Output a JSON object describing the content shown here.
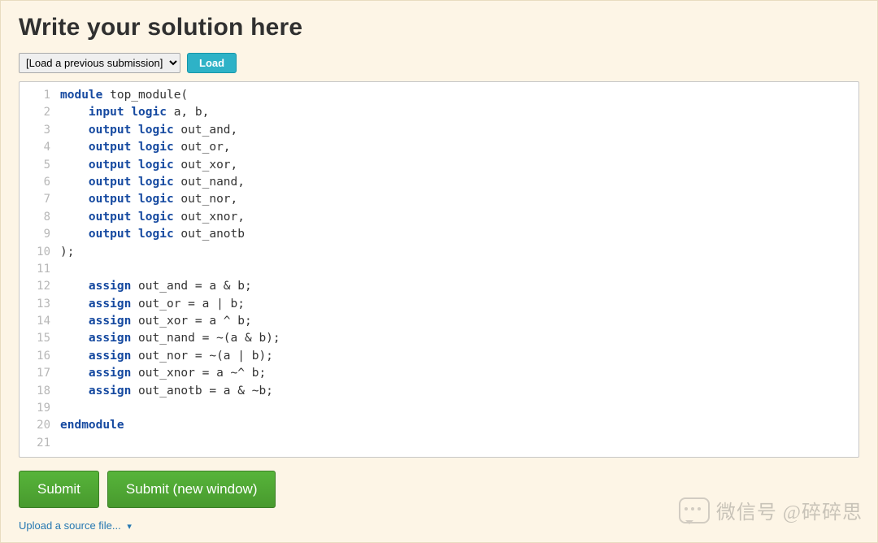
{
  "header": {
    "title": "Write your solution here"
  },
  "toolbar": {
    "prev_submission_selected": "[Load a previous submission]",
    "load_label": "Load"
  },
  "code": {
    "lines": [
      {
        "n": 1,
        "tokens": [
          {
            "c": "k",
            "t": "module"
          },
          {
            "c": "fn",
            "t": " top_module("
          }
        ]
      },
      {
        "n": 2,
        "tokens": [
          {
            "c": "fn",
            "t": "    "
          },
          {
            "c": "k",
            "t": "input"
          },
          {
            "c": "fn",
            "t": " "
          },
          {
            "c": "k",
            "t": "logic"
          },
          {
            "c": "fn",
            "t": " a, b,"
          }
        ]
      },
      {
        "n": 3,
        "tokens": [
          {
            "c": "fn",
            "t": "    "
          },
          {
            "c": "k",
            "t": "output"
          },
          {
            "c": "fn",
            "t": " "
          },
          {
            "c": "k",
            "t": "logic"
          },
          {
            "c": "fn",
            "t": " out_and,"
          }
        ]
      },
      {
        "n": 4,
        "tokens": [
          {
            "c": "fn",
            "t": "    "
          },
          {
            "c": "k",
            "t": "output"
          },
          {
            "c": "fn",
            "t": " "
          },
          {
            "c": "k",
            "t": "logic"
          },
          {
            "c": "fn",
            "t": " out_or,"
          }
        ]
      },
      {
        "n": 5,
        "tokens": [
          {
            "c": "fn",
            "t": "    "
          },
          {
            "c": "k",
            "t": "output"
          },
          {
            "c": "fn",
            "t": " "
          },
          {
            "c": "k",
            "t": "logic"
          },
          {
            "c": "fn",
            "t": " out_xor,"
          }
        ]
      },
      {
        "n": 6,
        "tokens": [
          {
            "c": "fn",
            "t": "    "
          },
          {
            "c": "k",
            "t": "output"
          },
          {
            "c": "fn",
            "t": " "
          },
          {
            "c": "k",
            "t": "logic"
          },
          {
            "c": "fn",
            "t": " out_nand,"
          }
        ]
      },
      {
        "n": 7,
        "tokens": [
          {
            "c": "fn",
            "t": "    "
          },
          {
            "c": "k",
            "t": "output"
          },
          {
            "c": "fn",
            "t": " "
          },
          {
            "c": "k",
            "t": "logic"
          },
          {
            "c": "fn",
            "t": " out_nor,"
          }
        ]
      },
      {
        "n": 8,
        "tokens": [
          {
            "c": "fn",
            "t": "    "
          },
          {
            "c": "k",
            "t": "output"
          },
          {
            "c": "fn",
            "t": " "
          },
          {
            "c": "k",
            "t": "logic"
          },
          {
            "c": "fn",
            "t": " out_xnor,"
          }
        ]
      },
      {
        "n": 9,
        "tokens": [
          {
            "c": "fn",
            "t": "    "
          },
          {
            "c": "k",
            "t": "output"
          },
          {
            "c": "fn",
            "t": " "
          },
          {
            "c": "k",
            "t": "logic"
          },
          {
            "c": "fn",
            "t": " out_anotb"
          }
        ]
      },
      {
        "n": 10,
        "tokens": [
          {
            "c": "fn",
            "t": ");"
          }
        ]
      },
      {
        "n": 11,
        "tokens": [
          {
            "c": "fn",
            "t": ""
          }
        ]
      },
      {
        "n": 12,
        "tokens": [
          {
            "c": "fn",
            "t": "    "
          },
          {
            "c": "k",
            "t": "assign"
          },
          {
            "c": "fn",
            "t": " out_and = a & b;"
          }
        ]
      },
      {
        "n": 13,
        "tokens": [
          {
            "c": "fn",
            "t": "    "
          },
          {
            "c": "k",
            "t": "assign"
          },
          {
            "c": "fn",
            "t": " out_or = a | b;"
          }
        ]
      },
      {
        "n": 14,
        "tokens": [
          {
            "c": "fn",
            "t": "    "
          },
          {
            "c": "k",
            "t": "assign"
          },
          {
            "c": "fn",
            "t": " out_xor = a ^ b;"
          }
        ]
      },
      {
        "n": 15,
        "tokens": [
          {
            "c": "fn",
            "t": "    "
          },
          {
            "c": "k",
            "t": "assign"
          },
          {
            "c": "fn",
            "t": " out_nand = ~(a & b);"
          }
        ]
      },
      {
        "n": 16,
        "tokens": [
          {
            "c": "fn",
            "t": "    "
          },
          {
            "c": "k",
            "t": "assign"
          },
          {
            "c": "fn",
            "t": " out_nor = ~(a | b);"
          }
        ]
      },
      {
        "n": 17,
        "tokens": [
          {
            "c": "fn",
            "t": "    "
          },
          {
            "c": "k",
            "t": "assign"
          },
          {
            "c": "fn",
            "t": " out_xnor = a ~^ b;"
          }
        ]
      },
      {
        "n": 18,
        "tokens": [
          {
            "c": "fn",
            "t": "    "
          },
          {
            "c": "k",
            "t": "assign"
          },
          {
            "c": "fn",
            "t": " out_anotb = a & ~b;"
          }
        ]
      },
      {
        "n": 19,
        "tokens": [
          {
            "c": "fn",
            "t": ""
          }
        ]
      },
      {
        "n": 20,
        "tokens": [
          {
            "c": "k",
            "t": "endmodule"
          }
        ]
      },
      {
        "n": 21,
        "tokens": [
          {
            "c": "fn",
            "t": ""
          }
        ]
      }
    ]
  },
  "buttons": {
    "submit": "Submit",
    "submit_new_window": "Submit (new window)"
  },
  "upload": {
    "link_text": "Upload a source file..."
  },
  "watermark": {
    "text": "微信号 @碎碎思"
  }
}
